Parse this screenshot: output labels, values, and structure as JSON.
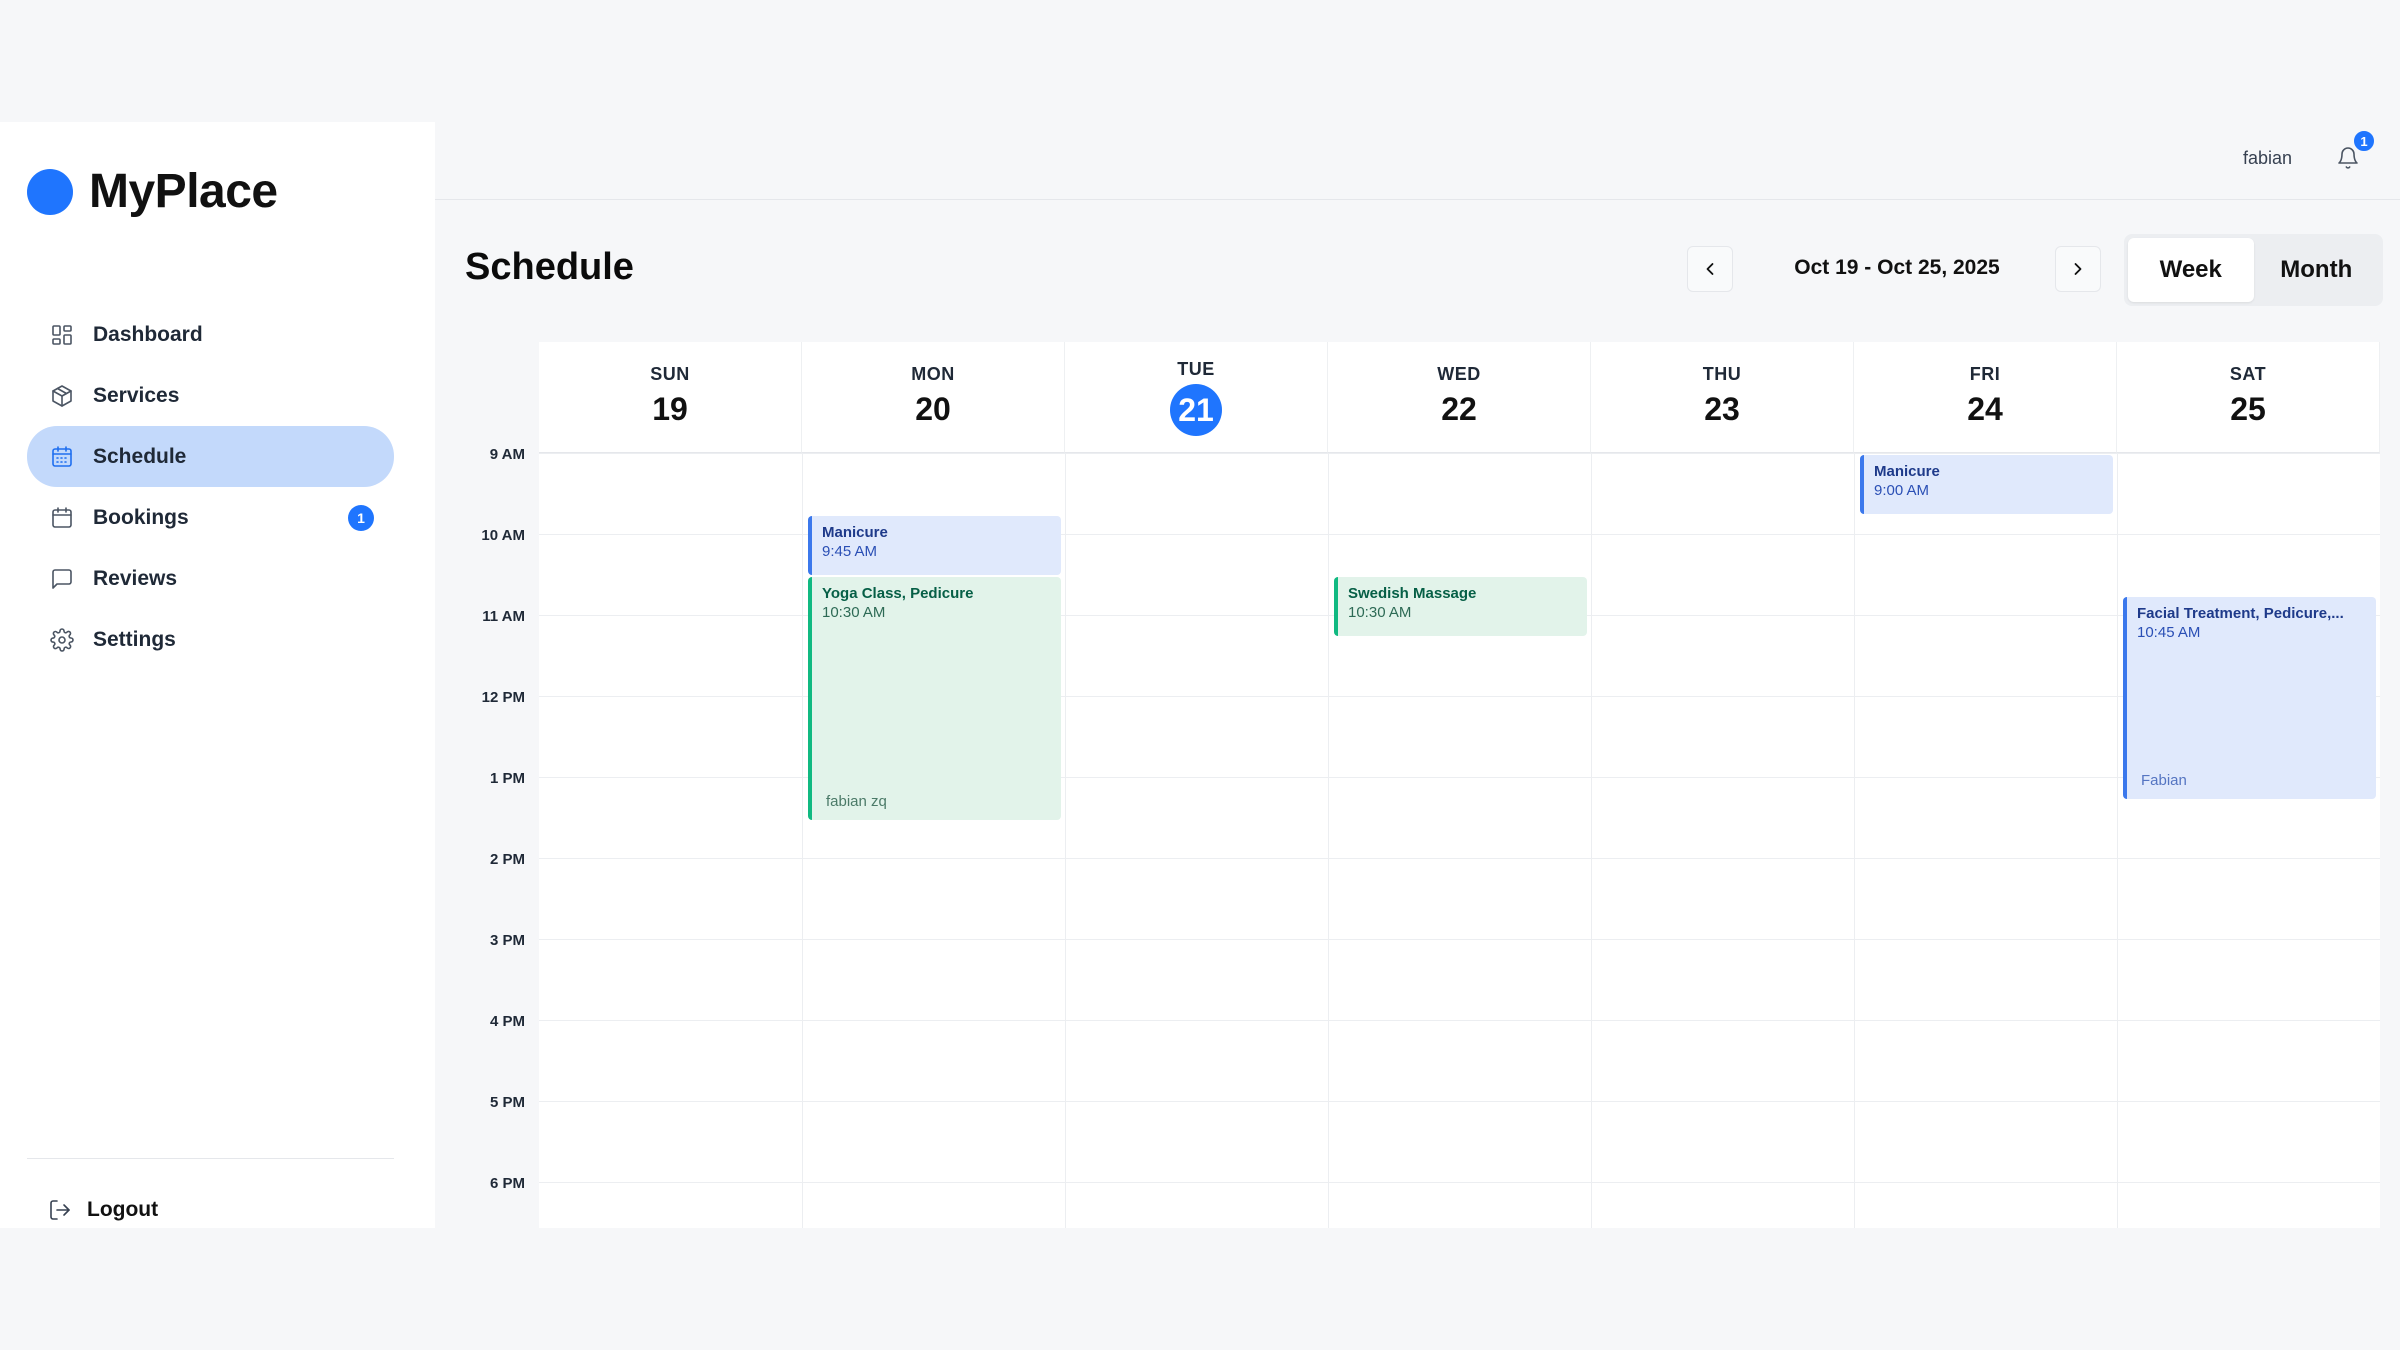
{
  "brand": {
    "name": "MyPlace",
    "color": "#1f75fe"
  },
  "sidebar": {
    "items": [
      {
        "label": "Dashboard",
        "icon": "grid-icon"
      },
      {
        "label": "Services",
        "icon": "package-icon"
      },
      {
        "label": "Schedule",
        "icon": "calendar-icon",
        "active": true
      },
      {
        "label": "Bookings",
        "icon": "calendar-icon",
        "badge": "1"
      },
      {
        "label": "Reviews",
        "icon": "message-icon"
      },
      {
        "label": "Settings",
        "icon": "gear-icon"
      }
    ],
    "logout": "Logout"
  },
  "topbar": {
    "user": "fabian",
    "notifications": "1"
  },
  "header": {
    "title": "Schedule",
    "date_range": "Oct 19 - Oct 25, 2025",
    "views": [
      "Week",
      "Month"
    ],
    "active_view": "Week"
  },
  "calendar": {
    "days": [
      {
        "dow": "SUN",
        "num": "19"
      },
      {
        "dow": "MON",
        "num": "20"
      },
      {
        "dow": "TUE",
        "num": "21",
        "today": true
      },
      {
        "dow": "WED",
        "num": "22"
      },
      {
        "dow": "THU",
        "num": "23"
      },
      {
        "dow": "FRI",
        "num": "24"
      },
      {
        "dow": "SAT",
        "num": "25"
      }
    ],
    "hours": [
      "9 AM",
      "10 AM",
      "11 AM",
      "12 PM",
      "1 PM",
      "2 PM",
      "3 PM",
      "4 PM",
      "5 PM",
      "6 PM"
    ],
    "events": [
      {
        "title": "Manicure",
        "time": "9:45 AM",
        "color": "blue"
      },
      {
        "title": "Yoga Class, Pedicure",
        "time": "10:30 AM",
        "person": "fabian zq",
        "color": "green"
      },
      {
        "title": "Swedish Massage",
        "time": "10:30 AM",
        "color": "green"
      },
      {
        "title": "Manicure",
        "time": "9:00 AM",
        "color": "blue"
      },
      {
        "title": "Facial Treatment, Pedicure,...",
        "time": "10:45 AM",
        "person": "Fabian",
        "color": "blue"
      }
    ]
  }
}
